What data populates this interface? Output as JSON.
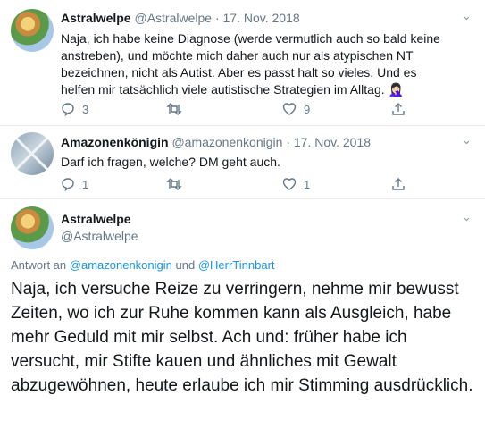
{
  "tweets": [
    {
      "name": "Astralwelpe",
      "handle": "@Astralwelpe",
      "date": "17. Nov. 2018",
      "text": "Naja, ich habe keine Diagnose (werde vermutlich auch so bald keine anstreben), und möchte mich daher auch nur als atypischen NT bezeichnen, nicht als Autist. Aber es passt halt so vieles. Und es helfen mir tatsächlich viele autistische Strategien im Alltag. 🤦🏻‍♀️",
      "replies": "3",
      "likes": "9"
    },
    {
      "name": "Amazonenkönigin",
      "handle": "@amazonenkonigin",
      "date": "17. Nov. 2018",
      "text": "Darf ich fragen, welche? DM geht auch.",
      "replies": "1",
      "likes": "1"
    }
  ],
  "main": {
    "name": "Astralwelpe",
    "handle": "@Astralwelpe",
    "reply_prefix": "Antwort an",
    "reply_user1": "@amazonenkonigin",
    "reply_and": "und",
    "reply_user2": "@HerrTinnbart",
    "text": "Naja, ich versuche Reize zu verringern, nehme mir bewusst Zeiten, wo ich zur Ruhe kommen kann als Ausgleich, habe mehr Geduld mit mir selbst. Ach und: früher habe ich versucht, mir Stifte kauen und ähnliches mit Gewalt abzugewöhnen, heute erlaube ich mir Stimming ausdrücklich."
  },
  "colors": {
    "link": "#1b95e0",
    "muted": "#657786",
    "text": "#14171a"
  }
}
